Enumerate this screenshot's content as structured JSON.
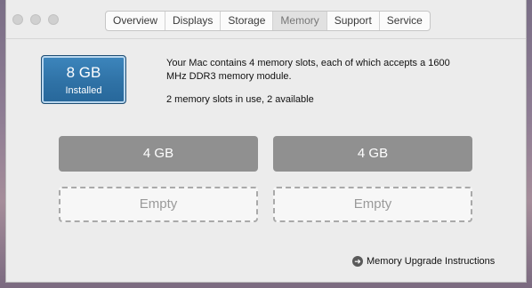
{
  "tabs": [
    {
      "label": "Overview"
    },
    {
      "label": "Displays"
    },
    {
      "label": "Storage"
    },
    {
      "label": "Memory",
      "active": true
    },
    {
      "label": "Support"
    },
    {
      "label": "Service"
    }
  ],
  "memory": {
    "size": "8 GB",
    "status": "Installed",
    "description_line1": "Your Mac contains 4 memory slots, each of which accepts a 1600 MHz DDR3 memory module.",
    "description_line2": "2 memory slots in use, 2 available"
  },
  "slots": [
    {
      "label": "4 GB",
      "state": "filled"
    },
    {
      "label": "4 GB",
      "state": "filled"
    },
    {
      "label": "Empty",
      "state": "empty"
    },
    {
      "label": "Empty",
      "state": "empty"
    }
  ],
  "link": {
    "label": "Memory Upgrade Instructions",
    "icon": "arrow-circle-icon"
  },
  "colors": {
    "accent": "#2f72a6",
    "slot_filled": "#909090",
    "window_bg": "#ececec"
  }
}
